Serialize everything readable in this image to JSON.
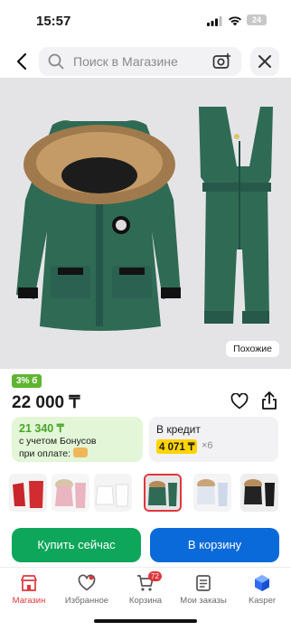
{
  "status_bar": {
    "time": "15:57",
    "battery": "24"
  },
  "search": {
    "placeholder": "Поиск в Магазине"
  },
  "product": {
    "similar_label": "Похожие",
    "discount_badge": "3% б",
    "price": "22 000 ₸"
  },
  "bonus_card": {
    "amount": "21 340 ₸",
    "line1": "с учетом Бонусов",
    "line2": "при оплате:"
  },
  "credit_card": {
    "title": "В кредит",
    "amount": "4 071 ₸",
    "multiplier": "×6"
  },
  "thumbnails": [
    {
      "name": "red-set"
    },
    {
      "name": "pink-set"
    },
    {
      "name": "white-set"
    },
    {
      "name": "green-set",
      "selected": true
    },
    {
      "name": "light-set"
    },
    {
      "name": "black-set"
    }
  ],
  "actions": {
    "buy_now": "Купить сейчас",
    "add_to_cart": "В корзину"
  },
  "tabbar": {
    "items": [
      {
        "label": "Магазин",
        "icon": "store-icon",
        "active": true
      },
      {
        "label": "Избранное",
        "icon": "heart-icon"
      },
      {
        "label": "Корзина",
        "icon": "cart-icon",
        "badge": "72"
      },
      {
        "label": "Мои заказы",
        "icon": "orders-icon"
      },
      {
        "label": "Kasper",
        "icon": "kasper-icon"
      }
    ]
  },
  "colors": {
    "jacket_green": "#2f6a55",
    "accent_red": "#e0373c",
    "buy_green": "#0ea65b",
    "cart_blue": "#0a6ad9",
    "bonus_bg": "#e3f6d7",
    "credit_yellow": "#ffd400"
  }
}
